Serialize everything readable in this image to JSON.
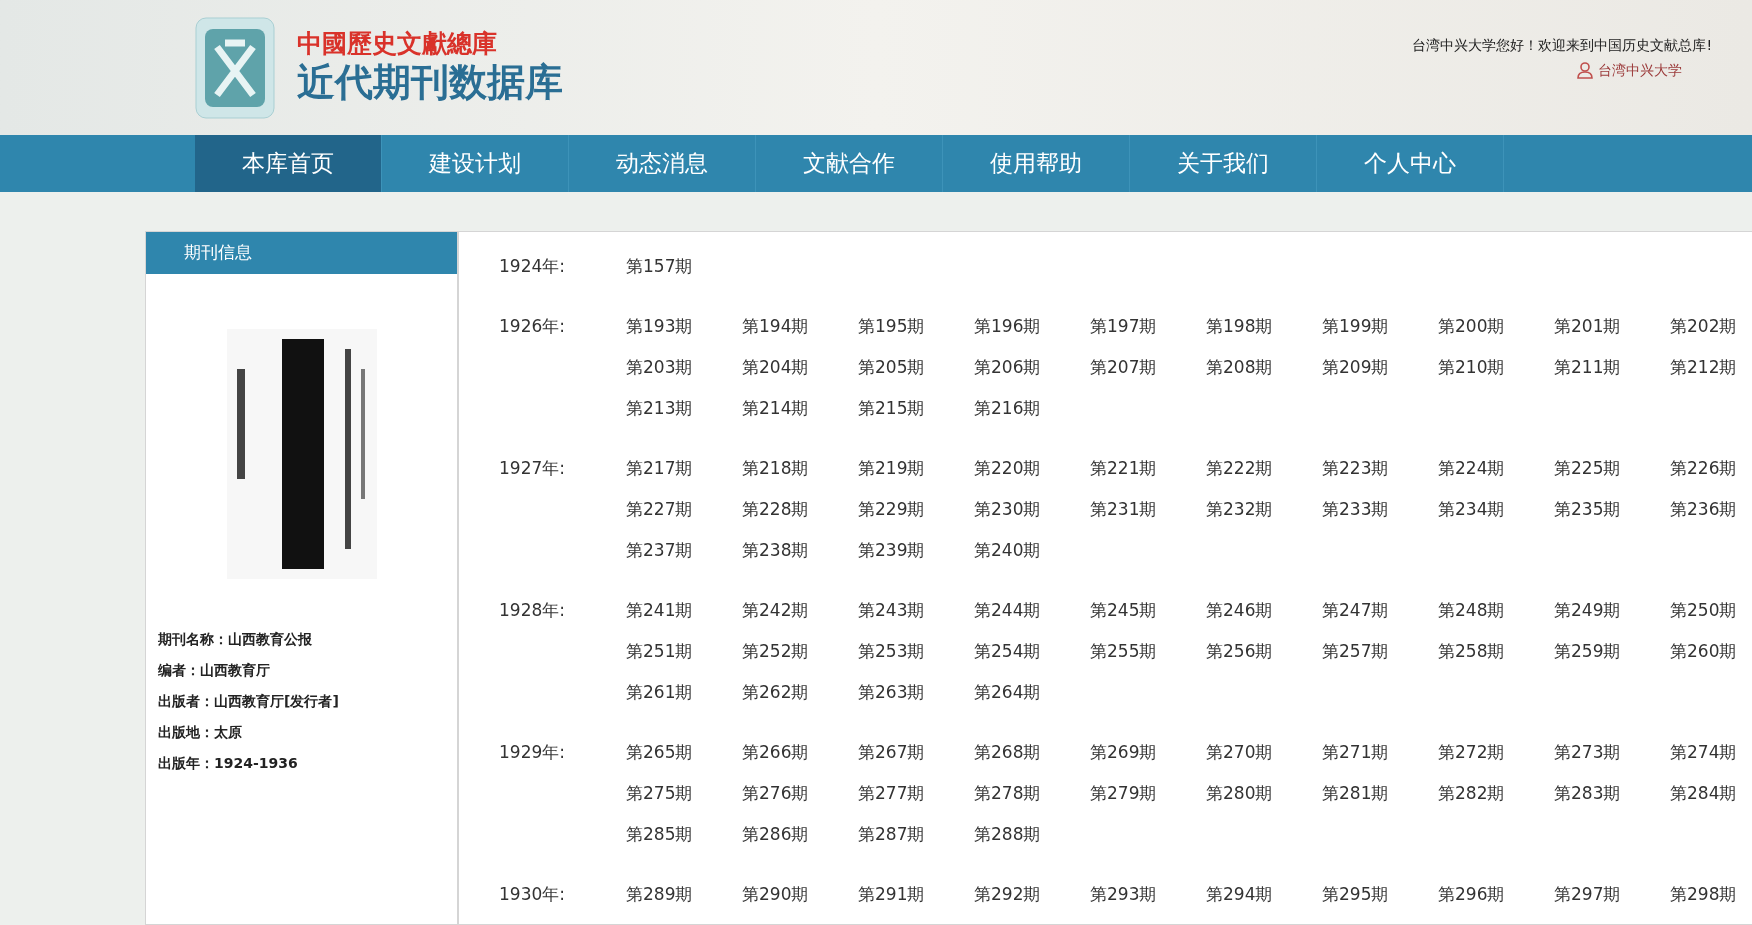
{
  "header": {
    "logo_line_1": "中國歷史文獻總庫",
    "logo_line_2": "近代期刊数据库",
    "welcome": "台湾中兴大学您好！欢迎来到中国历史文献总库!",
    "user": "台湾中兴大学"
  },
  "nav": [
    {
      "label": "本库首页",
      "selected": true
    },
    {
      "label": "建设计划",
      "selected": false
    },
    {
      "label": "动态消息",
      "selected": false
    },
    {
      "label": "文献合作",
      "selected": false
    },
    {
      "label": "使用帮助",
      "selected": false
    },
    {
      "label": "关于我们",
      "selected": false
    },
    {
      "label": "个人中心",
      "selected": false
    }
  ],
  "sidebar": {
    "title": "期刊信息",
    "fields": [
      {
        "label": "期刊名称：",
        "value": "山西教育公报"
      },
      {
        "label": "编者：",
        "value": "山西教育厅"
      },
      {
        "label": "出版者：",
        "value": "山西教育厅[发行者]"
      },
      {
        "label": "出版地：",
        "value": "太原"
      },
      {
        "label": "出版年：",
        "value": "1924-1936"
      }
    ]
  },
  "years": [
    {
      "year": "1924年:",
      "issues": [
        "第157期"
      ]
    },
    {
      "year": "1926年:",
      "issues": [
        "第193期",
        "第194期",
        "第195期",
        "第196期",
        "第197期",
        "第198期",
        "第199期",
        "第200期",
        "第201期",
        "第202期",
        "第203期",
        "第204期",
        "第205期",
        "第206期",
        "第207期",
        "第208期",
        "第209期",
        "第210期",
        "第211期",
        "第212期",
        "第213期",
        "第214期",
        "第215期",
        "第216期"
      ]
    },
    {
      "year": "1927年:",
      "issues": [
        "第217期",
        "第218期",
        "第219期",
        "第220期",
        "第221期",
        "第222期",
        "第223期",
        "第224期",
        "第225期",
        "第226期",
        "第227期",
        "第228期",
        "第229期",
        "第230期",
        "第231期",
        "第232期",
        "第233期",
        "第234期",
        "第235期",
        "第236期",
        "第237期",
        "第238期",
        "第239期",
        "第240期"
      ]
    },
    {
      "year": "1928年:",
      "issues": [
        "第241期",
        "第242期",
        "第243期",
        "第244期",
        "第245期",
        "第246期",
        "第247期",
        "第248期",
        "第249期",
        "第250期",
        "第251期",
        "第252期",
        "第253期",
        "第254期",
        "第255期",
        "第256期",
        "第257期",
        "第258期",
        "第259期",
        "第260期",
        "第261期",
        "第262期",
        "第263期",
        "第264期"
      ]
    },
    {
      "year": "1929年:",
      "issues": [
        "第265期",
        "第266期",
        "第267期",
        "第268期",
        "第269期",
        "第270期",
        "第271期",
        "第272期",
        "第273期",
        "第274期",
        "第275期",
        "第276期",
        "第277期",
        "第278期",
        "第279期",
        "第280期",
        "第281期",
        "第282期",
        "第283期",
        "第284期",
        "第285期",
        "第286期",
        "第287期",
        "第288期"
      ]
    },
    {
      "year": "1930年:",
      "issues": [
        "第289期",
        "第290期",
        "第291期",
        "第292期",
        "第293期",
        "第294期",
        "第295期",
        "第296期",
        "第297期",
        "第298期"
      ]
    }
  ]
}
